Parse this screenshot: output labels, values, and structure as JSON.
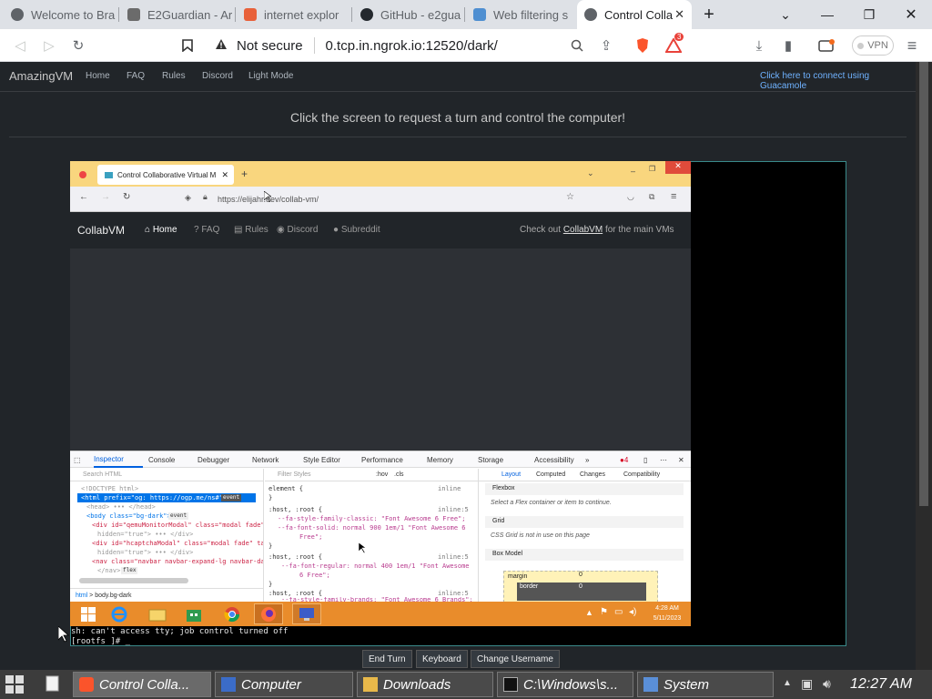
{
  "browser": {
    "tabs": [
      {
        "label": "Welcome to Bra",
        "icon": "globe-icon"
      },
      {
        "label": "E2Guardian - Ar",
        "icon": "shield-icon"
      },
      {
        "label": "internet explor",
        "icon": "brave-icon"
      },
      {
        "label": "GitHub - e2gua",
        "icon": "github-icon"
      },
      {
        "label": "Web filtering s",
        "icon": "network-icon"
      },
      {
        "label": "Control Colla",
        "icon": "globe-icon",
        "active": true
      }
    ],
    "security": "Not secure",
    "url": "0.tcp.in.ngrok.io:12520/dark/",
    "badge_count": "3",
    "vpn_label": "VPN"
  },
  "site": {
    "brand": "AmazingVM",
    "nav": [
      "Home",
      "FAQ",
      "Rules",
      "Discord",
      "Light Mode"
    ],
    "guacamole_link": "Click here to connect using Guacamole",
    "banner": "Click the screen to request a turn and control the computer!"
  },
  "vm": {
    "ff_tab": "Control Collaborative Virtual M",
    "ff_url": "https://elijahr.dev/collab-vm/",
    "cv_brand": "CollabVM",
    "cv_nav": [
      "Home",
      "FAQ",
      "Rules",
      "Discord",
      "Subreddit"
    ],
    "cv_right_prefix": "Check out",
    "cv_right_link": "CollabVM",
    "cv_right_suffix": "for the main VMs",
    "devtools_tabs": [
      "Inspector",
      "Console",
      "Debugger",
      "Network",
      "Style Editor",
      "Performance",
      "Memory",
      "Storage",
      "Accessibility"
    ],
    "devtools_errors": "4",
    "search_html": "Search HTML",
    "filter_styles": "Filter Styles",
    "hov": ":hov",
    "cls": ".cls",
    "html_lines": [
      "<!DOCTYPE html>",
      "<html prefix=\"og: https://ogp.me/ns#\">",
      "<head> ••• </head>",
      "<body class=\"bg-dark\">",
      "<div id=\"qemuMonitorModal\" class=\"modal fade\"",
      "hidden=\"true\"> ••• </div>",
      "<div id=\"hcaptchaModal\" class=\"modal fade\" ta",
      "hidden=\"true\"> ••• </div>",
      "<nav class=\"navbar navbar-expand-lg navbar-da",
      "</nav>"
    ],
    "event_badge_1": "event",
    "event_badge_2": "event",
    "flex_badge": "flex",
    "breadcrumb": [
      "html",
      "body.bg-dark"
    ],
    "css_lines": [
      "element {",
      "}",
      ":host, :root {",
      "--fa-style-family-classic: \"Font Awesome 6 Free\";",
      "--fa-font-solid: normal 900 1em/1 \"Font Awesome 6",
      "Free\";",
      "}",
      ":host, :root {",
      "--fa-font-regular: normal 400 1em/1 \"Font Awesome",
      "6 Free\";",
      "}",
      ":host, :root {",
      "--fa-style-family-brands: \"Font Awesome 6 Brands\";"
    ],
    "css_inline": [
      "inline",
      "inline:5",
      "inline:5",
      "inline:5"
    ],
    "layout_tabs": [
      "Layout",
      "Computed",
      "Changes",
      "Compatibility"
    ],
    "flexbox_title": "Flexbox",
    "flexbox_text": "Select a Flex container or item to continue.",
    "grid_title": "Grid",
    "grid_text": "CSS Grid is not in use on this page",
    "boxmodel_title": "Box Model",
    "margin_label": "margin",
    "margin_value": "0",
    "border_label": "border",
    "border_value": "0",
    "clock_time": "4:28 AM",
    "clock_date": "5/11/2023"
  },
  "terminal": {
    "line1": "sh: can't access tty; job control turned off",
    "line2": "[rootfs ]# _"
  },
  "controls": [
    "End Turn",
    "Keyboard",
    "Change Username"
  ],
  "taskbar": {
    "items": [
      {
        "label": "Control Colla...",
        "icon": "brave-icon"
      },
      {
        "label": "Computer",
        "icon": "computer-icon"
      },
      {
        "label": "Downloads",
        "icon": "folder-icon"
      },
      {
        "label": "C:\\Windows\\s...",
        "icon": "cmd-icon"
      },
      {
        "label": "System",
        "icon": "system-icon"
      }
    ],
    "clock": "12:27 AM"
  },
  "colors": {
    "accent_teal": "#3a8a8a",
    "ff_tab_bar": "#f9d67e",
    "win8_taskbar": "#e98c2b",
    "link_blue": "#6fb2ff"
  }
}
